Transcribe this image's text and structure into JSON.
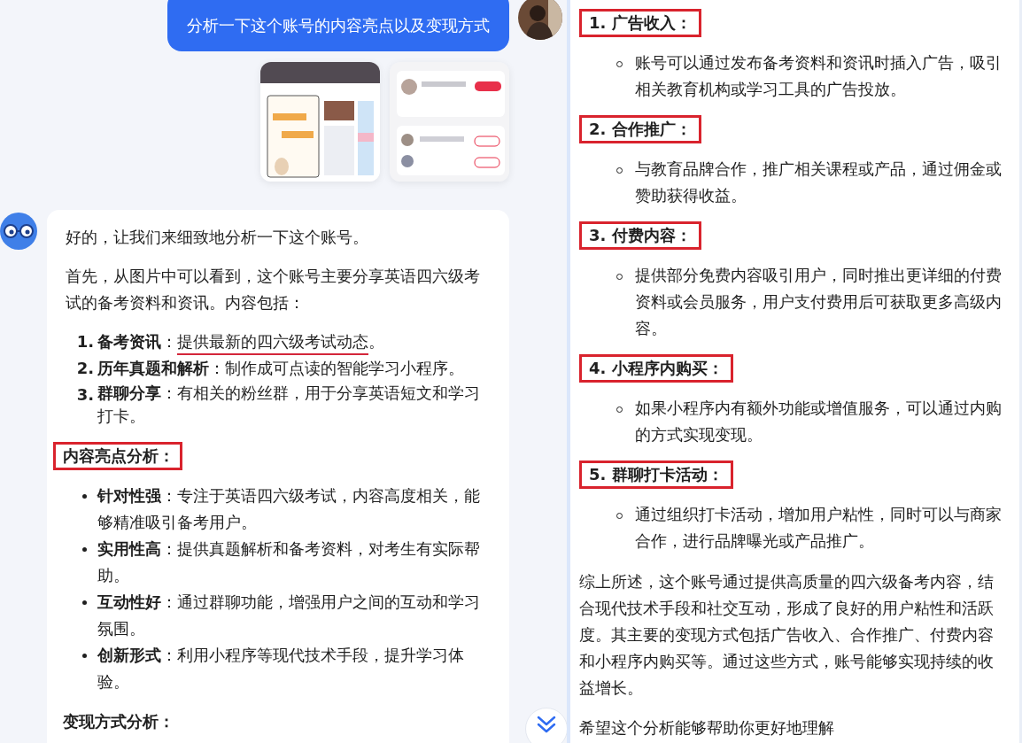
{
  "chat": {
    "user_message": {
      "text": "分析一下这个账号的内容亮点以及变现方式"
    },
    "reply": {
      "intro": "好的，让我们来细致地分析一下这个账号。",
      "paragraph": "首先，从图片中可以看到，这个账号主要分享英语四六级考试的备考资料和资讯。内容包括：",
      "points": [
        {
          "number": "1.",
          "parts": [
            {
              "text": "**备考资讯**：",
              "underlined": false
            },
            {
              "text": "提供最新的四六级考试动态",
              "underlined": true
            },
            {
              "text": "。",
              "underlined": false
            }
          ]
        },
        {
          "number": "2.",
          "parts": [
            {
              "text": "**历年真题和解析**：制作成可点读的智能学习小程序。",
              "underlined": false
            }
          ]
        },
        {
          "number": "3.",
          "parts": [
            {
              "text": "**群聊分享**：有相关的粉丝群，用于分享英语短文和学习打卡。",
              "underlined": false
            }
          ]
        }
      ],
      "sections": [
        {
          "heading": "内容亮点分析：",
          "boxed": true,
          "items": [
            "**针对性强**：专注于英语四六级考试，内容高度相关，能够精准吸引备考用户。",
            "**实用性高**：提供真题解析和备考资料，对考生有实际帮助。",
            "**互动性好**：通过群聊功能，增强用户之间的互动和学习氛围。",
            "**创新形式**：利用小程序等现代技术手段，提升学习体验。"
          ]
        },
        {
          "heading": "变现方式分析：",
          "boxed": false
        }
      ]
    }
  },
  "continuation": {
    "methods": [
      {
        "title": "1. 广告收入：",
        "boxed": true,
        "detail": "账号可以通过发布备考资料和资讯时插入广告，吸引相关教育机构或学习工具的广告投放。"
      },
      {
        "title": "2. 合作推广：",
        "boxed": true,
        "detail": "与教育品牌合作，推广相关课程或产品，通过佣金或赞助获得收益。"
      },
      {
        "title": "3. 付费内容：",
        "boxed": true,
        "detail": "提供部分免费内容吸引用户，同时推出更详细的付费资料或会员服务，用户支付费用后可获取更多高级内容。"
      },
      {
        "title": "4. 小程序内购买：",
        "boxed": true,
        "detail": "如果小程序内有额外功能或增值服务，可以通过内购的方式实现变现。"
      },
      {
        "title": "5. 群聊打卡活动：",
        "boxed": true,
        "detail": "通过组织打卡活动，增加用户粘性，同时可以与商家合作，进行品牌曝光或产品推广。"
      }
    ],
    "summary": "综上所述，这个账号通过提供高质量的四六级备考内容，结合现代技术手段和社交互动，形成了良好的用户粘性和活跃度。其主要的变现方式包括广告收入、合作推广、付费内容和小程序内购买等。通过这些方式，账号能够实现持续的收益增长。",
    "closing": "希望这个分析能够帮助你更好地理解"
  }
}
